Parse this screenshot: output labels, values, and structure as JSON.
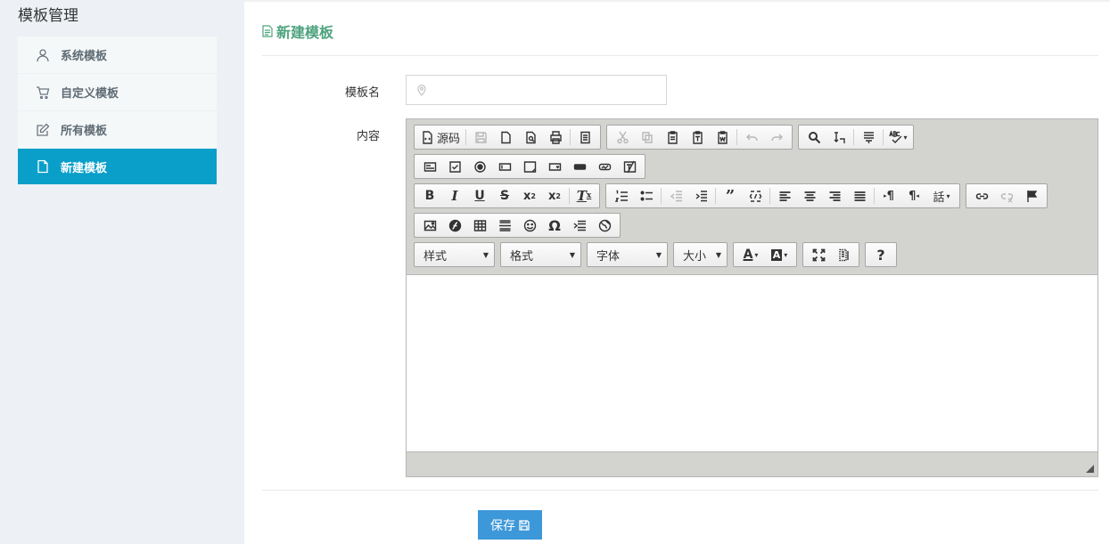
{
  "sidebar": {
    "title": "模板管理",
    "items": [
      {
        "label": "系统模板",
        "icon": "user-icon"
      },
      {
        "label": "自定义模板",
        "icon": "cart-icon"
      },
      {
        "label": "所有模板",
        "icon": "edit-icon"
      },
      {
        "label": "新建模板",
        "icon": "file-icon",
        "active": true
      }
    ]
  },
  "main": {
    "title": "新建模板",
    "form": {
      "name_label": "模板名",
      "name_value": "",
      "content_label": "内容"
    },
    "editor": {
      "source_label": "源码",
      "combos": {
        "style": "样式",
        "format": "格式",
        "font": "字体",
        "size": "大小"
      },
      "help_label": "?"
    },
    "save_label": "保存"
  },
  "colors": {
    "accent": "#0a9fc9",
    "title": "#4ea37e",
    "save": "#3d98d9"
  }
}
